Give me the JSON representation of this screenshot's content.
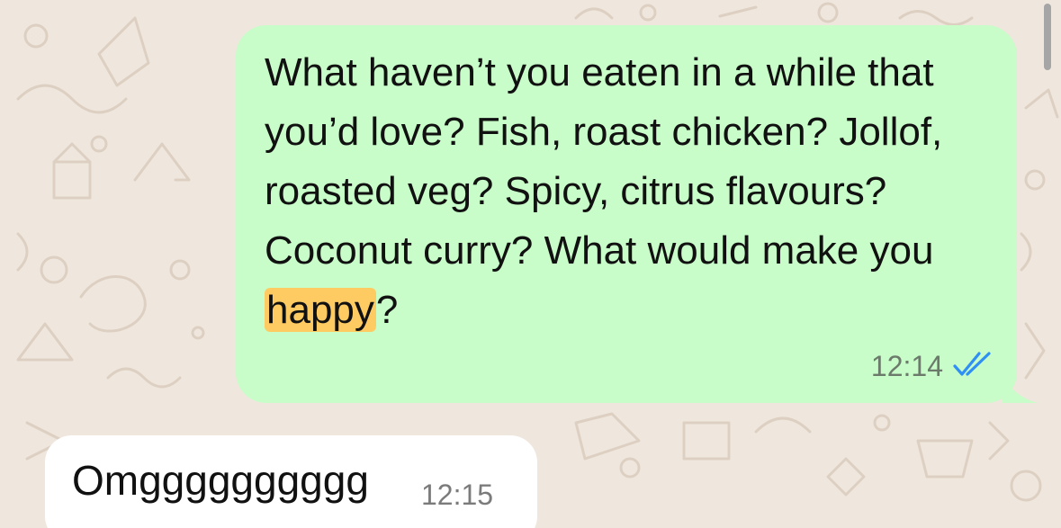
{
  "messages": {
    "outgoing": {
      "text_before": "What haven’t you eaten in a while that you’d love? Fish, roast chicken? Jollof, roasted veg? Spicy, citrus flavours? Coconut curry? What would make you ",
      "highlight": "happy",
      "text_after": "?",
      "time": "12:14",
      "status_icon": "double-check-icon",
      "status": "read"
    },
    "incoming": {
      "text": "Omgggggggggg",
      "time": "12:15"
    }
  },
  "colors": {
    "chat_background": "#efe7dd",
    "outgoing_bubble": "#c8fcc8",
    "incoming_bubble": "#ffffff",
    "highlight": "#fecb62",
    "read_ticks": "#2f8ff5"
  },
  "icons": {
    "scrollbar": "scrollbar-thumb"
  }
}
